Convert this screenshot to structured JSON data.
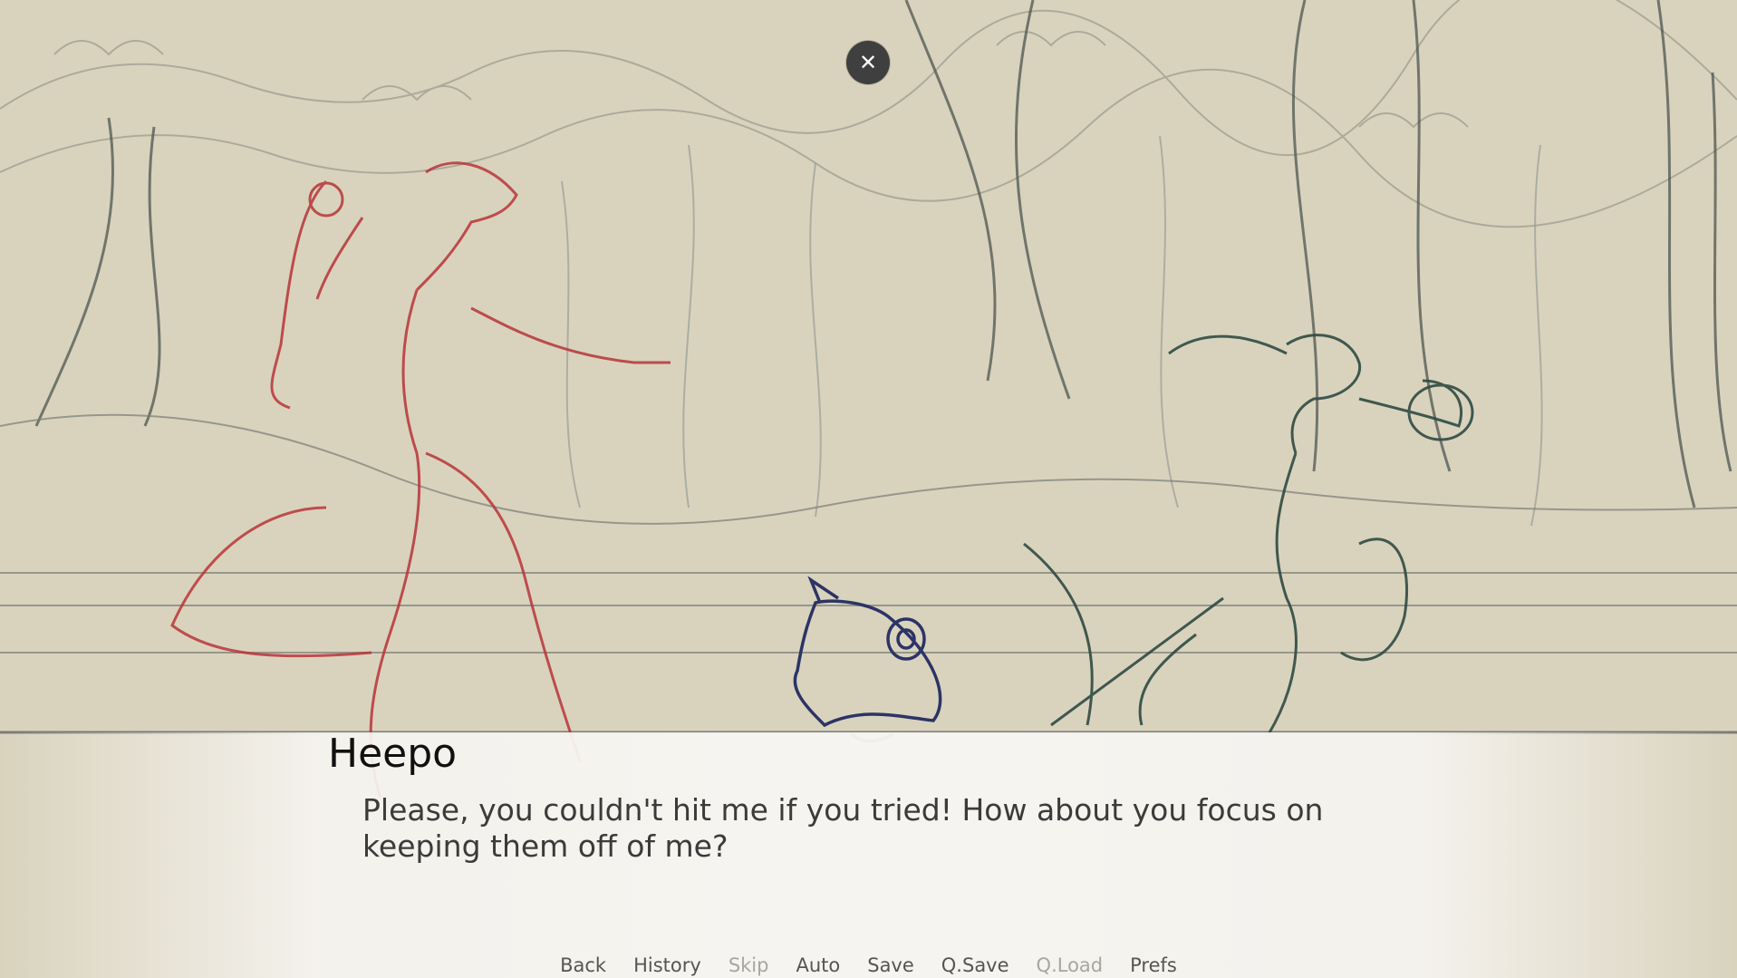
{
  "scene": {
    "background_color": "#d9d3bd",
    "left_character_color": "#b8343a",
    "right_character_color": "#2f4a44",
    "center_prop_color": "#2c3466",
    "sketch_line_color": "#6f6f68"
  },
  "close_button": {
    "icon": "close-icon",
    "glyph": "✕"
  },
  "dialogue": {
    "speaker": "Heepo",
    "text": "Please, you couldn't hit me if you tried! How about you focus on keeping them off of me?"
  },
  "quick_menu": {
    "back": "Back",
    "history": "History",
    "skip": "Skip",
    "auto": "Auto",
    "save": "Save",
    "qsave": "Q.Save",
    "qload": "Q.Load",
    "prefs": "Prefs"
  }
}
